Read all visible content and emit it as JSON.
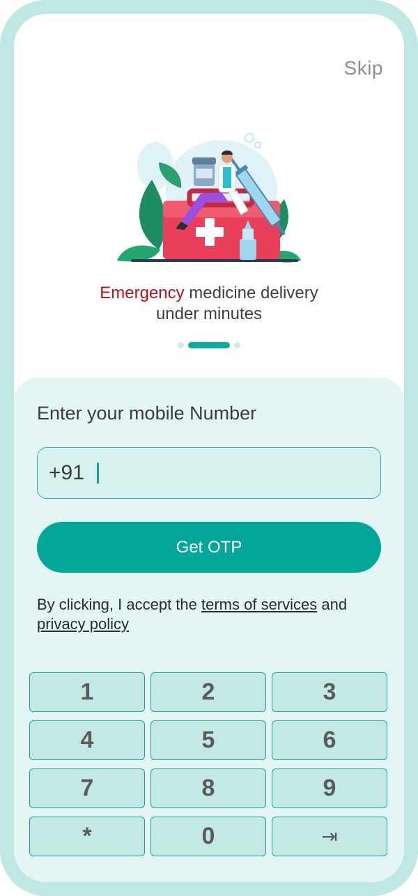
{
  "header": {
    "skip_label": "Skip"
  },
  "onboarding": {
    "tagline_accent": "Emergency",
    "tagline_line1_rest": " medicine delivery",
    "tagline_line2": "under minutes",
    "pagination": {
      "total": 3,
      "active_index": 1
    }
  },
  "login": {
    "title": "Enter your mobile Number",
    "country_code": "+91",
    "phone_value": "",
    "get_otp_label": "Get OTP",
    "consent_prefix": "By clicking, I accept the ",
    "terms_link": "terms of services",
    "consent_and": " and",
    "privacy_link": "privacy policy"
  },
  "keypad": {
    "keys": [
      "1",
      "2",
      "3",
      "4",
      "5",
      "6",
      "7",
      "8",
      "9",
      "*",
      "0",
      "⇥"
    ]
  },
  "colors": {
    "accent": "#02a79a",
    "emergency_red": "#b5121b",
    "sheet_bg": "#e4f6f4",
    "key_bg": "#c3e9e5",
    "frame": "#bfe8e5"
  },
  "icons": [
    "medical-kit-illustration",
    "tab-key-icon"
  ]
}
